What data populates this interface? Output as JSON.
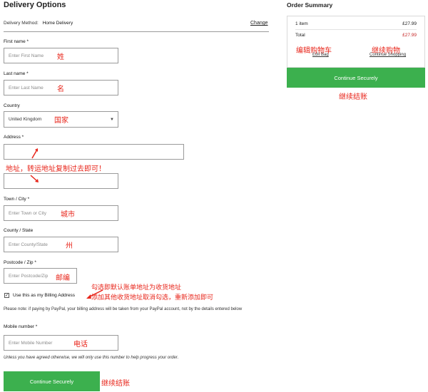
{
  "delivery": {
    "title": "Delivery Options",
    "method_label": "Delivery Method:",
    "method_value": "Home Delivery",
    "change_label": "Change"
  },
  "form": {
    "first_name": {
      "label": "First name *",
      "placeholder": "Enter First Name"
    },
    "last_name": {
      "label": "Last name *",
      "placeholder": "Enter Last Name"
    },
    "country": {
      "label": "Country",
      "selected": "United Kingdom"
    },
    "address": {
      "label": "Address *",
      "line1": "",
      "line2": ""
    },
    "town": {
      "label": "Town / City *",
      "placeholder": "Enter Town or City"
    },
    "county": {
      "label": "County / State",
      "placeholder": "Enter County/State"
    },
    "postcode": {
      "label": "Postcode / Zip *",
      "placeholder": "Enter Postcode/Zip"
    },
    "billing_checkbox": {
      "label": "Use this as my Billing Address",
      "checked": true
    },
    "paypal_note": "Please note: if paying by PayPal, your billing address will be taken from your PayPal account, not by the details entered below",
    "mobile": {
      "label": "Mobile number *",
      "placeholder": "Enter Mobile Number"
    },
    "mobile_note": "Unless you have agreed otherwise, we will only use this number to help progress your order.",
    "continue_label": "Continue Securely"
  },
  "summary": {
    "title": "Order Summary",
    "items_label": "1 item",
    "items_price": "£27.99",
    "total_label": "Total",
    "total_price": "£27.99",
    "edit_bag": "Edit Bag",
    "continue_shopping": "Continue Shopping",
    "continue_label": "Continue Securely"
  },
  "annotations": {
    "first_name": "姓",
    "last_name": "名",
    "country": "国家",
    "address": "地址，转运地址复制过去即可！",
    "city": "城市",
    "state": "州",
    "postcode": "邮编",
    "billing_line1": "勾选即默认账单地址为收货地址",
    "billing_line2": "添加其他收货地址取消勾选，重新添加即可",
    "mobile": "电话",
    "continue_bottom": "继续结账",
    "edit_bag": "编辑购物车",
    "continue_shopping": "继续购物",
    "continue_right": "继续结账"
  },
  "colors": {
    "accent_green": "#3cb04e",
    "annotation_red": "#e8261b",
    "price_red": "#c62828"
  }
}
